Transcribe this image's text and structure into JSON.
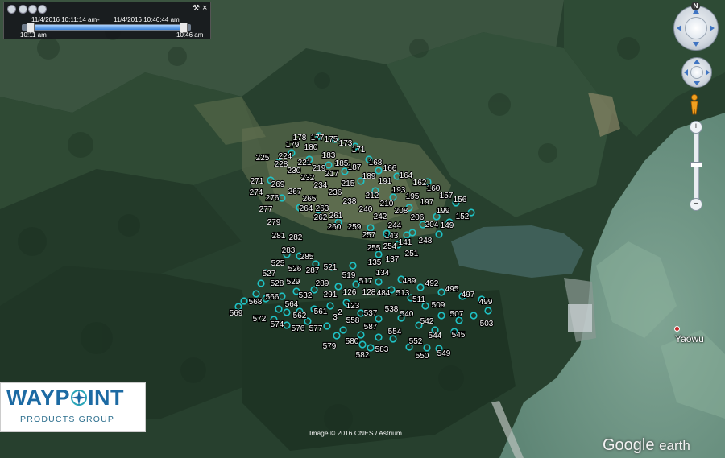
{
  "time_slider": {
    "start": "11/4/2016 10:11:14 am",
    "separator": "-",
    "end": "11/4/2016 10:46:44 am",
    "left_label": "10:11 am",
    "right_label": "10:46 am",
    "settings_icon": "wrench-icon",
    "close_label": "×"
  },
  "navigation": {
    "north_label": "N",
    "zoom_in_label": "+",
    "zoom_out_label": "−",
    "zoom_level": 0.48,
    "icons": [
      "look-ring-icon",
      "move-ring-icon",
      "pegman-icon"
    ]
  },
  "logo": {
    "word_left": "WAYP",
    "word_right": "INT",
    "subtitle": "PRODUCTS GROUP"
  },
  "place": {
    "name": "Yaowu"
  },
  "attribution": "Image © 2016 CNES / Astrium",
  "brand": {
    "bold": "Google",
    "light": "earth"
  },
  "colors": {
    "waypoint": "#1fc2c5",
    "slider_range": "#3c82d8",
    "logo_blue": "#1c6aa3"
  },
  "waypoints": [
    {
      "label": "178"
    },
    {
      "label": "177"
    },
    {
      "label": "175"
    },
    {
      "label": "173"
    },
    {
      "label": "171"
    },
    {
      "label": "179"
    },
    {
      "label": "180"
    },
    {
      "label": "183"
    },
    {
      "label": "185"
    },
    {
      "label": "187"
    },
    {
      "label": "168"
    },
    {
      "label": "166"
    },
    {
      "label": "164"
    },
    {
      "label": "162"
    },
    {
      "label": "160"
    },
    {
      "label": "157"
    },
    {
      "label": "156"
    },
    {
      "label": "225"
    },
    {
      "label": "224"
    },
    {
      "label": "228"
    },
    {
      "label": "221"
    },
    {
      "label": "219"
    },
    {
      "label": "217"
    },
    {
      "label": "189"
    },
    {
      "label": "191"
    },
    {
      "label": "193"
    },
    {
      "label": "195"
    },
    {
      "label": "197"
    },
    {
      "label": "199"
    },
    {
      "label": "152"
    },
    {
      "label": "230"
    },
    {
      "label": "232"
    },
    {
      "label": "234"
    },
    {
      "label": "215"
    },
    {
      "label": "212"
    },
    {
      "label": "210"
    },
    {
      "label": "208"
    },
    {
      "label": "206"
    },
    {
      "label": "204"
    },
    {
      "label": "149"
    },
    {
      "label": "271"
    },
    {
      "label": "269"
    },
    {
      "label": "267"
    },
    {
      "label": "236"
    },
    {
      "label": "238"
    },
    {
      "label": "240"
    },
    {
      "label": "242"
    },
    {
      "label": "244"
    },
    {
      "label": "274"
    },
    {
      "label": "276"
    },
    {
      "label": "265"
    },
    {
      "label": "264"
    },
    {
      "label": "263"
    },
    {
      "label": "262"
    },
    {
      "label": "261"
    },
    {
      "label": "277"
    },
    {
      "label": "279"
    },
    {
      "label": "260"
    },
    {
      "label": "259"
    },
    {
      "label": "257"
    },
    {
      "label": "143"
    },
    {
      "label": "141"
    },
    {
      "label": "248"
    },
    {
      "label": "281"
    },
    {
      "label": "282"
    },
    {
      "label": "255"
    },
    {
      "label": "254"
    },
    {
      "label": "251"
    },
    {
      "label": "283"
    },
    {
      "label": "285"
    },
    {
      "label": "135"
    },
    {
      "label": "137"
    },
    {
      "label": "525"
    },
    {
      "label": "526"
    },
    {
      "label": "287"
    },
    {
      "label": "521"
    },
    {
      "label": "519"
    },
    {
      "label": "134"
    },
    {
      "label": "527"
    },
    {
      "label": "528"
    },
    {
      "label": "529"
    },
    {
      "label": "289"
    },
    {
      "label": "517"
    },
    {
      "label": "489"
    },
    {
      "label": "492"
    },
    {
      "label": "495"
    },
    {
      "label": "497"
    },
    {
      "label": "566"
    },
    {
      "label": "532"
    },
    {
      "label": "291"
    },
    {
      "label": "126"
    },
    {
      "label": "128"
    },
    {
      "label": "484"
    },
    {
      "label": "513"
    },
    {
      "label": "511"
    },
    {
      "label": "568"
    },
    {
      "label": "564"
    },
    {
      "label": "123"
    },
    {
      "label": "537"
    },
    {
      "label": "538"
    },
    {
      "label": "509"
    },
    {
      "label": "499"
    },
    {
      "label": "569"
    },
    {
      "label": "562"
    },
    {
      "label": "561"
    },
    {
      "label": "3"
    },
    {
      "label": "2"
    },
    {
      "label": "540"
    },
    {
      "label": "507"
    },
    {
      "label": "572"
    },
    {
      "label": "558"
    },
    {
      "label": "542"
    },
    {
      "label": "503"
    },
    {
      "label": "574"
    },
    {
      "label": "576"
    },
    {
      "label": "577"
    },
    {
      "label": "587"
    },
    {
      "label": "554"
    },
    {
      "label": "544"
    },
    {
      "label": "545"
    },
    {
      "label": "552"
    },
    {
      "label": "579"
    },
    {
      "label": "580"
    },
    {
      "label": "583"
    },
    {
      "label": "582"
    },
    {
      "label": "550"
    },
    {
      "label": "549"
    }
  ]
}
